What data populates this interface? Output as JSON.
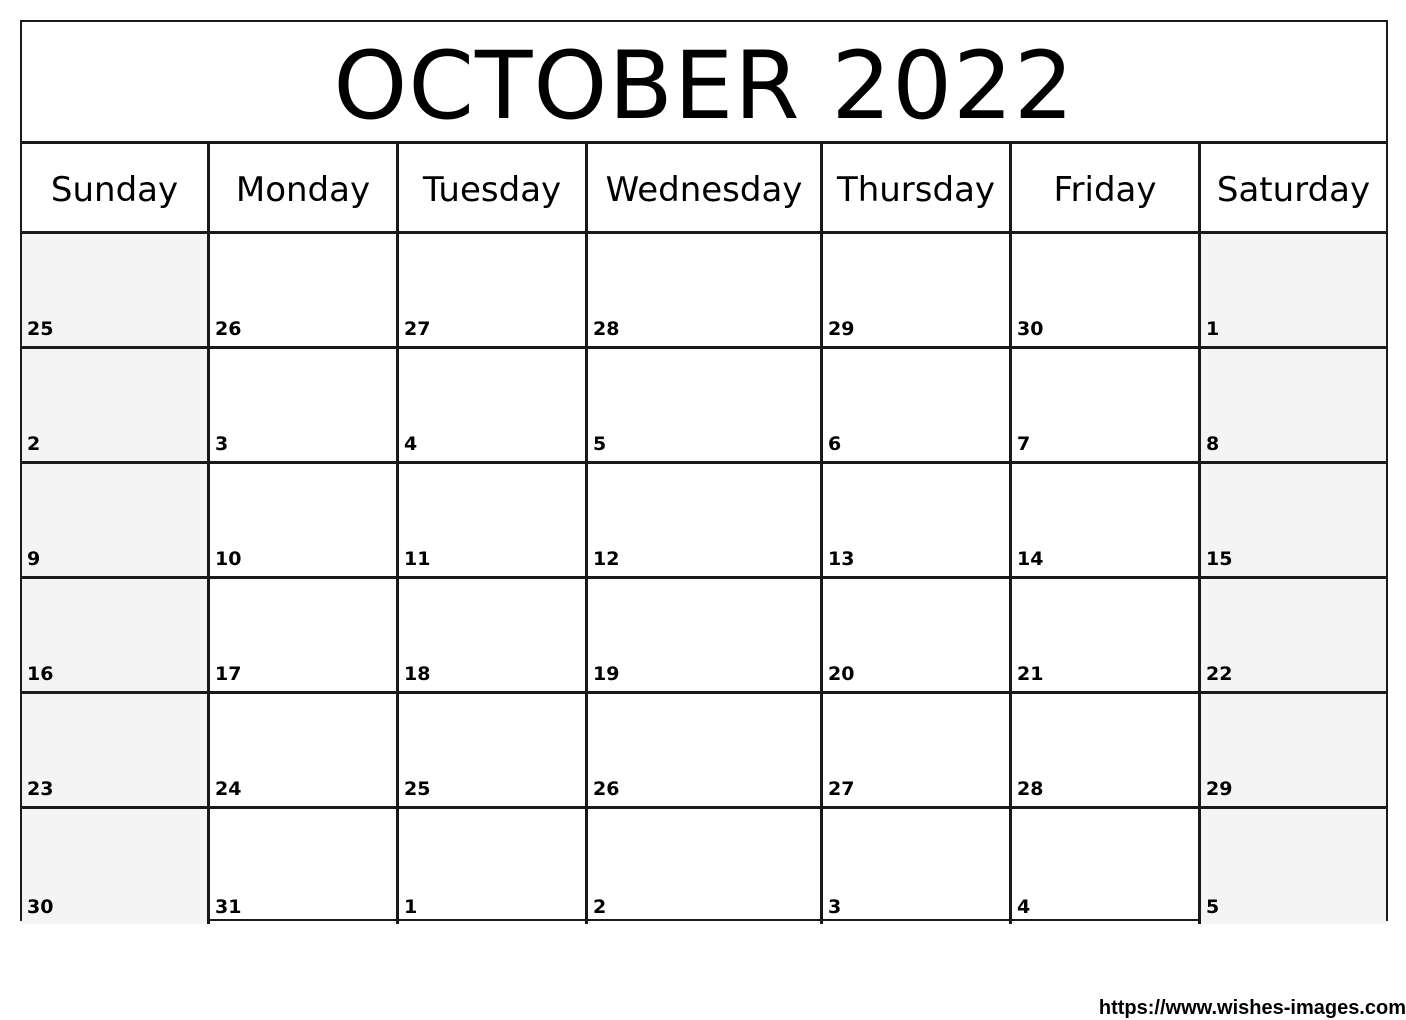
{
  "calendar": {
    "title": "OCTOBER 2022",
    "weekdays": [
      "Sunday",
      "Monday",
      "Tuesday",
      "Wednesday",
      "Thursday",
      "Friday",
      "Saturday"
    ],
    "weekend_shade_color": "#f4f4f4",
    "weeks": [
      [
        "25",
        "26",
        "27",
        "28",
        "29",
        "30",
        "1"
      ],
      [
        "2",
        "3",
        "4",
        "5",
        "6",
        "7",
        "8"
      ],
      [
        "9",
        "10",
        "11",
        "12",
        "13",
        "14",
        "15"
      ],
      [
        "16",
        "17",
        "18",
        "19",
        "20",
        "21",
        "22"
      ],
      [
        "23",
        "24",
        "25",
        "26",
        "27",
        "28",
        "29"
      ],
      [
        "30",
        "31",
        "1",
        "2",
        "3",
        "4",
        "5"
      ]
    ]
  },
  "footer": {
    "url_text": "https://www.wishes-images.com"
  }
}
